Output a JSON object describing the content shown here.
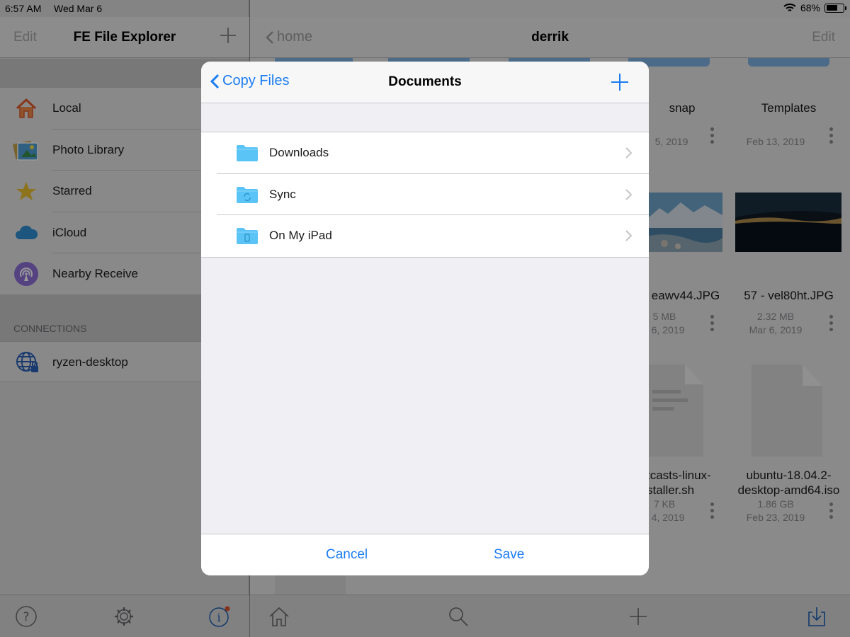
{
  "status_bar": {
    "time": "6:57 AM",
    "date": "Wed Mar 6",
    "battery": "68%",
    "battery_level": 0.68
  },
  "sidebar": {
    "edit_label": "Edit",
    "title": "FE File Explorer",
    "items": [
      {
        "label": "Local",
        "icon": "home-icon"
      },
      {
        "label": "Photo Library",
        "icon": "photos-icon"
      },
      {
        "label": "Starred",
        "icon": "star-icon"
      },
      {
        "label": "iCloud",
        "icon": "cloud-icon"
      },
      {
        "label": "Nearby Receive",
        "icon": "airdrop-icon"
      }
    ],
    "connections_header": "CONNECTIONS",
    "connections": [
      {
        "label": "ryzen-desktop",
        "icon": "globe-lock-icon"
      }
    ]
  },
  "main": {
    "back_label": "home",
    "title": "derrik",
    "edit_label": "Edit",
    "files": [
      {
        "name": "snap",
        "date": "5, 2019"
      },
      {
        "name": "Templates",
        "date": "Feb 13, 2019"
      },
      {
        "name": "eawv44.JPG",
        "size": "5 MB",
        "date": "6, 2019"
      },
      {
        "name": "57 - vel80ht.JPG",
        "size": "2.32 MB",
        "date": "Mar 6, 2019"
      },
      {
        "name_line1": "tcasts-linux-",
        "name_line2": "staller.sh",
        "size": "7 KB",
        "date": "4, 2019"
      },
      {
        "name_line1": "ubuntu-18.04.2-",
        "name_line2": "desktop-amd64.iso",
        "size": "1.86 GB",
        "date": "Feb 23, 2019"
      }
    ]
  },
  "modal": {
    "back_label": "Copy Files",
    "title": "Documents",
    "folders": [
      {
        "label": "Downloads"
      },
      {
        "label": "Sync"
      },
      {
        "label": "On My iPad"
      }
    ],
    "cancel_label": "Cancel",
    "save_label": "Save"
  },
  "colors": {
    "accent": "#1b7cf2",
    "folder": "#5ac4f7"
  }
}
